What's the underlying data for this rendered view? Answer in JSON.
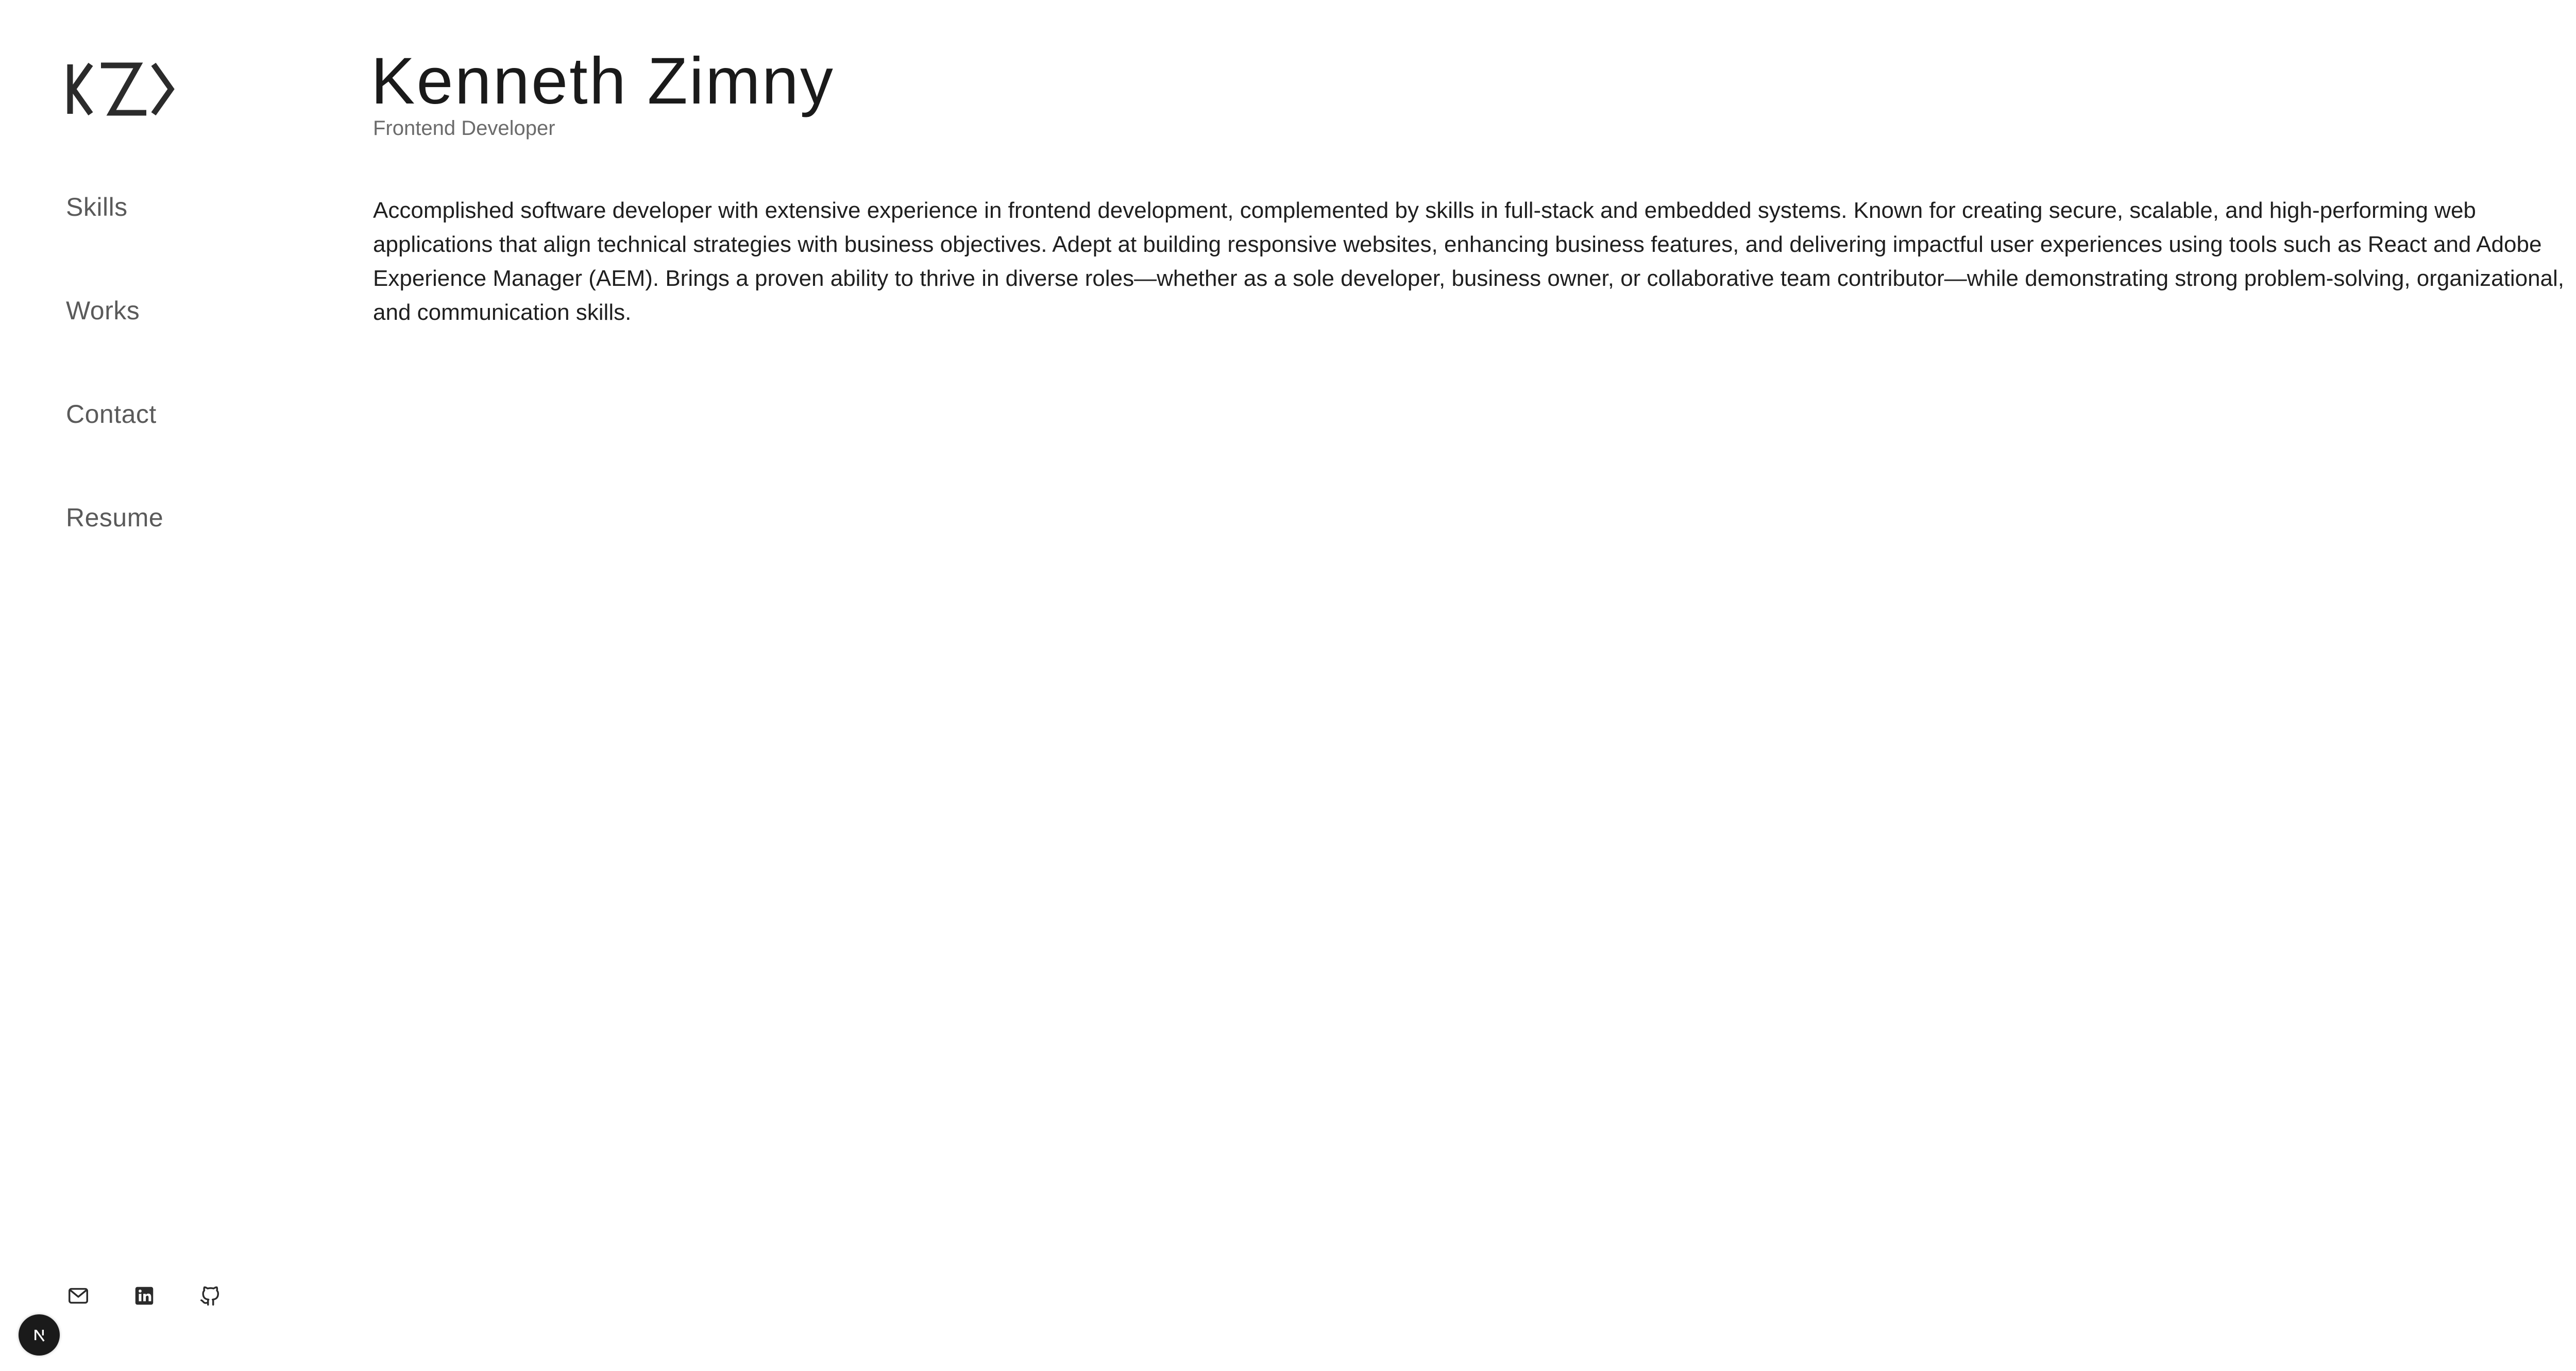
{
  "brand": {
    "logo_text": "KZ",
    "logo_icon": "kz-monogram-logo"
  },
  "sidebar": {
    "items": [
      {
        "label": "Skills"
      },
      {
        "label": "Works"
      },
      {
        "label": "Contact"
      },
      {
        "label": "Resume"
      }
    ]
  },
  "header": {
    "name": "Kenneth Zimny",
    "role": "Frontend Developer"
  },
  "main": {
    "bio": "Accomplished software developer with extensive experience in frontend development, complemented by skills in full-stack and embedded systems. Known for creating secure, scalable, and high-performing web applications that align technical strategies with business objectives. Adept at building responsive websites, enhancing business features, and delivering impactful user experiences using tools such as React and Adobe Experience Manager (AEM). Brings a proven ability to thrive in diverse roles—whether as a sole developer, business owner, or collaborative team contributor—while demonstrating strong problem-solving, organizational, and communication skills."
  },
  "social": {
    "icons": [
      "mail-icon",
      "linkedin-icon",
      "github-icon"
    ]
  },
  "badge": {
    "icon": "nextjs-icon"
  },
  "colors": {
    "background": "#ffffff",
    "text": "#1f1f1f",
    "muted": "#5a5a5a",
    "badge": "#1a1a1a"
  }
}
